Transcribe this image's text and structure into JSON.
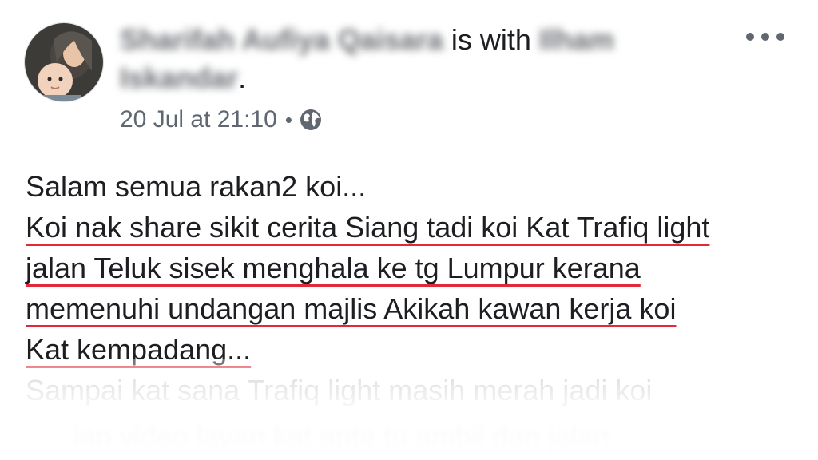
{
  "post": {
    "author": "Sharifah Aufiya Qaisara",
    "with_text": "is with",
    "tagged_first": "Ilham",
    "tagged_second": "Iskandar",
    "tagged_end": ".",
    "timestamp": "20 Jul at 21:10",
    "separator": "•",
    "privacy_icon": "globe-icon",
    "more_icon": "more-options-icon"
  },
  "content": {
    "lines": [
      "Salam semua rakan2 koi...",
      "Koi nak share sikit cerita Siang tadi koi Kat Trafiq light",
      "jalan Teluk sisek menghala ke tg Lumpur kerana",
      "memenuhi undangan majlis Akikah kawan kerja koi",
      "Kat kempadang..."
    ],
    "faded_lines": [
      "Sampai kat sana Trafiq light masih merah jadi koi",
      "..ian video layan kat ante tu ambil dan jalan"
    ]
  },
  "colors": {
    "underline": "#e02a3a",
    "text": "#1c1e21",
    "meta": "#606770"
  }
}
